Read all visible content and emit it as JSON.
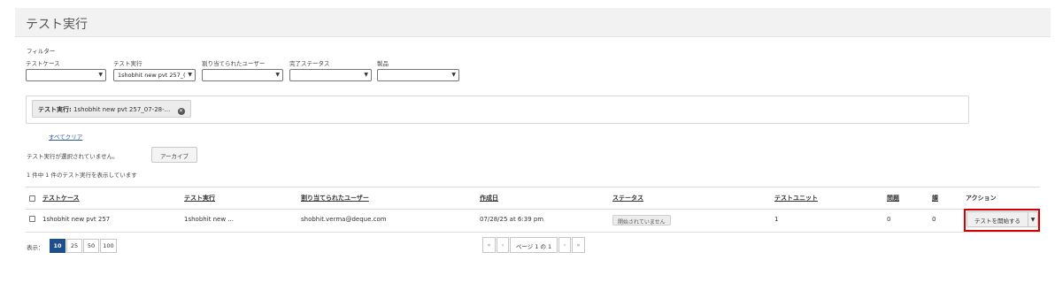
{
  "header": {
    "title": "テスト実行"
  },
  "filters": {
    "label": "フィルター",
    "items": [
      {
        "label": "テストケース",
        "value": ""
      },
      {
        "label": "テスト実行",
        "value": "1shobhit new pvt 257_("
      },
      {
        "label": "割り当てられたユーザー",
        "value": ""
      },
      {
        "label": "完了ステータス",
        "value": ""
      },
      {
        "label": "製品",
        "value": ""
      }
    ],
    "dropdown_arrow": "▼"
  },
  "chips": [
    {
      "key": "テスト実行:",
      "value": "1shobhit new pvt 257_07-28-...",
      "remove_icon": "✕"
    }
  ],
  "clear_all": "すべてクリア",
  "selection_status": "テスト実行が選択されていません。",
  "archive_button": "アーカイブ",
  "showing_text": "1 件中 1 件のテスト実行を表示しています",
  "table": {
    "headers": {
      "test_case": "テストケース",
      "test_run": "テスト実行",
      "assigned_user": "割り当てられたユーザー",
      "created": "作成日",
      "status": "ステータス",
      "test_unit": "テストユニット",
      "issues": "問題",
      "comments": "課",
      "actions": "アクション"
    },
    "rows": [
      {
        "test_case": "1shobhit new pvt 257",
        "test_run": "1shobhit new ...",
        "assigned_user": "shobhit.verma@deque.com",
        "created": "07/28/25 at 6:39 pm",
        "status": "開始されていません",
        "test_unit": "1",
        "issues": "0",
        "comments": "0",
        "action_label": "テストを開始する",
        "action_caret": "▼"
      }
    ]
  },
  "pagination": {
    "show_label": "表示：",
    "page_sizes": [
      "10",
      "25",
      "50",
      "100"
    ],
    "selected_page_size": "10",
    "first": "«",
    "prev": "‹",
    "page_text": "ページ 1 の 1",
    "next": "›",
    "last": "»"
  },
  "colors": {
    "accent": "#1f4e8c",
    "link": "#2e5c9a",
    "highlight": "#d40000"
  }
}
